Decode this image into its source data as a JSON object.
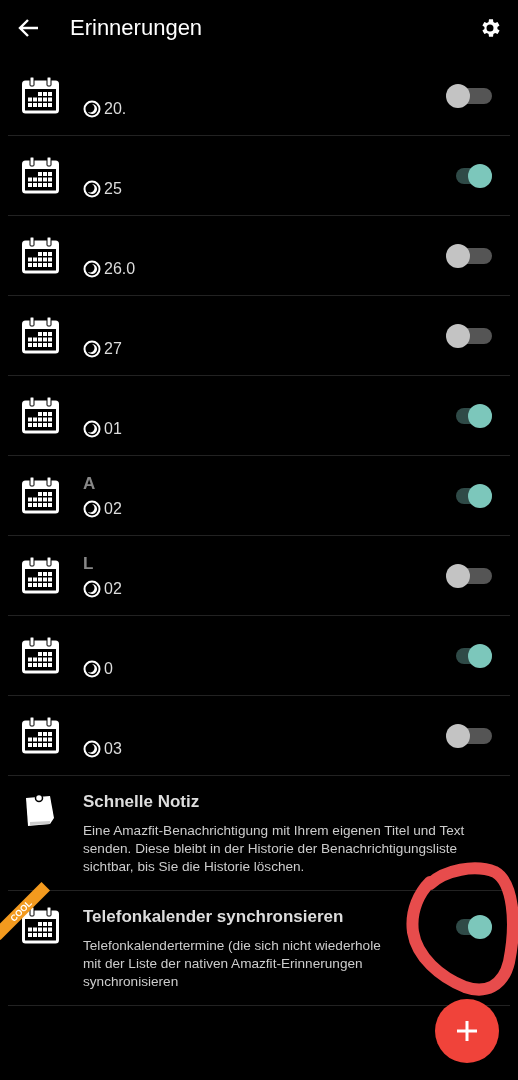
{
  "header": {
    "title": "Erinnerungen"
  },
  "reminders": [
    {
      "time": "20.",
      "on": false
    },
    {
      "time": "25",
      "on": true
    },
    {
      "time": "26.0",
      "on": false
    },
    {
      "time": "27",
      "on": false
    },
    {
      "time": "01",
      "on": true
    },
    {
      "title": "A",
      "time": "02",
      "on": true
    },
    {
      "title": "L",
      "time": "02",
      "on": false
    },
    {
      "time": "0",
      "on": true
    },
    {
      "time": "03",
      "on": false
    }
  ],
  "quick_note": {
    "title": "Schnelle Notiz",
    "description": "Eine Amazfit-Benachrichtigung mit Ihrem eigenen Titel und Text senden. Diese bleibt in der Historie der Benachrichtigungsliste sichtbar, bis Sie die Historie löschen."
  },
  "sync": {
    "badge": "COOL",
    "title": "Telefonkalender synchronsieren",
    "description_lines": [
      "Telefonkalendertermine (die sich nicht wiederhole",
      "mit der Liste der nativen Amazfit-Erinnerungen",
      "synchronisieren"
    ],
    "on": true
  }
}
